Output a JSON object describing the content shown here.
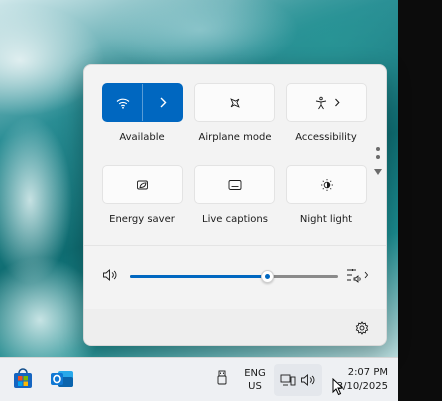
{
  "quick_settings": {
    "tiles": [
      {
        "id": "wifi",
        "label": "Available",
        "icon": "wifi-icon",
        "active": true,
        "has_chevron": true
      },
      {
        "id": "airplane",
        "label": "Airplane mode",
        "icon": "airplane-icon",
        "active": false,
        "has_chevron": false
      },
      {
        "id": "accessibility",
        "label": "Accessibility",
        "icon": "accessibility-icon",
        "active": false,
        "has_chevron": true
      },
      {
        "id": "energy",
        "label": "Energy saver",
        "icon": "energy-saver-icon",
        "active": false,
        "has_chevron": false
      },
      {
        "id": "captions",
        "label": "Live captions",
        "icon": "captions-icon",
        "active": false,
        "has_chevron": false
      },
      {
        "id": "nightlight",
        "label": "Night light",
        "icon": "night-light-icon",
        "active": false,
        "has_chevron": false
      }
    ],
    "volume": {
      "level": 0.66,
      "icon": "speaker-icon",
      "output_icon": "audio-output-icon"
    },
    "footer": {
      "settings_icon": "gear-icon"
    },
    "accent_color": "#0067c0"
  },
  "taskbar": {
    "apps": [
      {
        "name": "Microsoft Store",
        "icon": "store-icon"
      },
      {
        "name": "Outlook",
        "icon": "outlook-icon"
      }
    ],
    "tray": {
      "language_line1": "ENG",
      "language_line2": "US",
      "time": "2:07 PM",
      "date": "3/10/2025"
    }
  }
}
